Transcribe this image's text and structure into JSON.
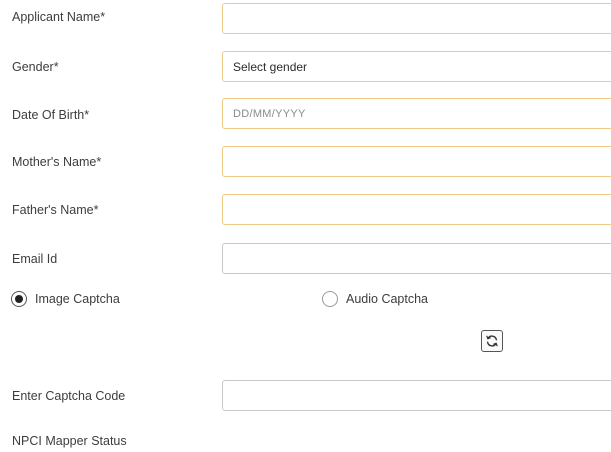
{
  "form": {
    "applicant_name": {
      "label": "Applicant Name*",
      "value": ""
    },
    "gender": {
      "label": "Gender*",
      "selected": "Select gender"
    },
    "dob": {
      "label": "Date Of Birth*",
      "placeholder": "DD/MM/YYYY"
    },
    "mother_name": {
      "label": "Mother's Name*",
      "value": ""
    },
    "father_name": {
      "label": "Father's Name*",
      "value": ""
    },
    "email": {
      "label": "Email Id",
      "value": ""
    },
    "captcha_type": {
      "options": [
        {
          "label": "Image Captcha",
          "checked": true
        },
        {
          "label": "Audio Captcha",
          "checked": false
        }
      ],
      "refresh_icon": "refresh-icon"
    },
    "captcha_code": {
      "label": "Enter Captcha Code",
      "value": ""
    },
    "npci_status": {
      "label": "NPCI Mapper Status"
    }
  },
  "colors": {
    "required_border": "#f0c987",
    "optional_border": "#c9c9c9"
  }
}
